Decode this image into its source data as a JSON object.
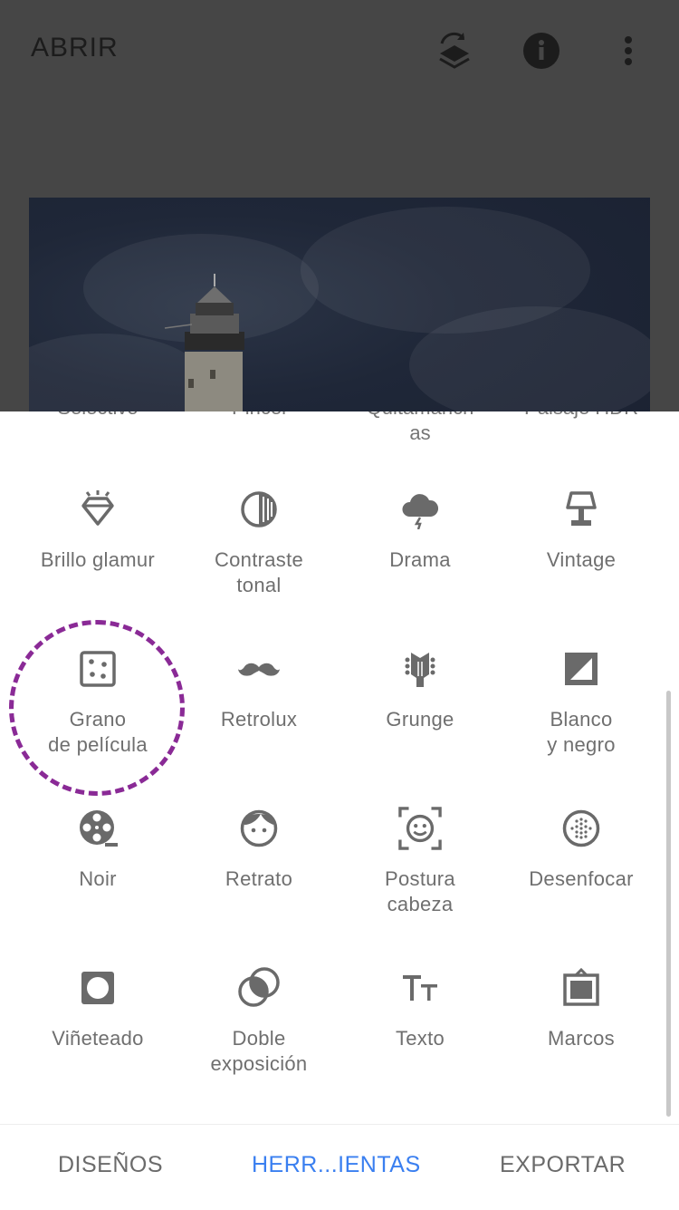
{
  "header": {
    "open_label": "ABRIR",
    "icons": [
      "layers-undo-icon",
      "info-icon",
      "more-vert-icon"
    ]
  },
  "partial_row": [
    {
      "label": "Selectivo"
    },
    {
      "label": "Pincel"
    },
    {
      "label": "Quitamanch\nas"
    },
    {
      "label": "Paisaje HDR"
    }
  ],
  "tools": [
    {
      "label": "Brillo glamur",
      "icon": "diamond-icon"
    },
    {
      "label": "Contraste\ntonal",
      "icon": "tonal-contrast-icon"
    },
    {
      "label": "Drama",
      "icon": "storm-cloud-icon"
    },
    {
      "label": "Vintage",
      "icon": "lamp-icon"
    },
    {
      "label": "Grano\nde película",
      "icon": "grain-icon"
    },
    {
      "label": "Retrolux",
      "icon": "mustache-icon"
    },
    {
      "label": "Grunge",
      "icon": "guitar-head-icon"
    },
    {
      "label": "Blanco\ny negro",
      "icon": "black-white-icon"
    },
    {
      "label": "Noir",
      "icon": "film-reel-icon"
    },
    {
      "label": "Retrato",
      "icon": "face-icon"
    },
    {
      "label": "Postura\ncabeza",
      "icon": "head-pose-icon"
    },
    {
      "label": "Desenfocar",
      "icon": "blur-icon"
    },
    {
      "label": "Viñeteado",
      "icon": "vignette-icon"
    },
    {
      "label": "Doble\nexposición",
      "icon": "double-exposure-icon"
    },
    {
      "label": "Texto",
      "icon": "text-icon"
    },
    {
      "label": "Marcos",
      "icon": "frame-icon"
    }
  ],
  "nav": {
    "designs": "DISEÑOS",
    "tools": "HERR...IENTAS",
    "export": "EXPORTAR"
  },
  "colors": {
    "accent": "#3a7ff0",
    "highlight": "#8a2a96",
    "icon": "#6a6a6a"
  }
}
